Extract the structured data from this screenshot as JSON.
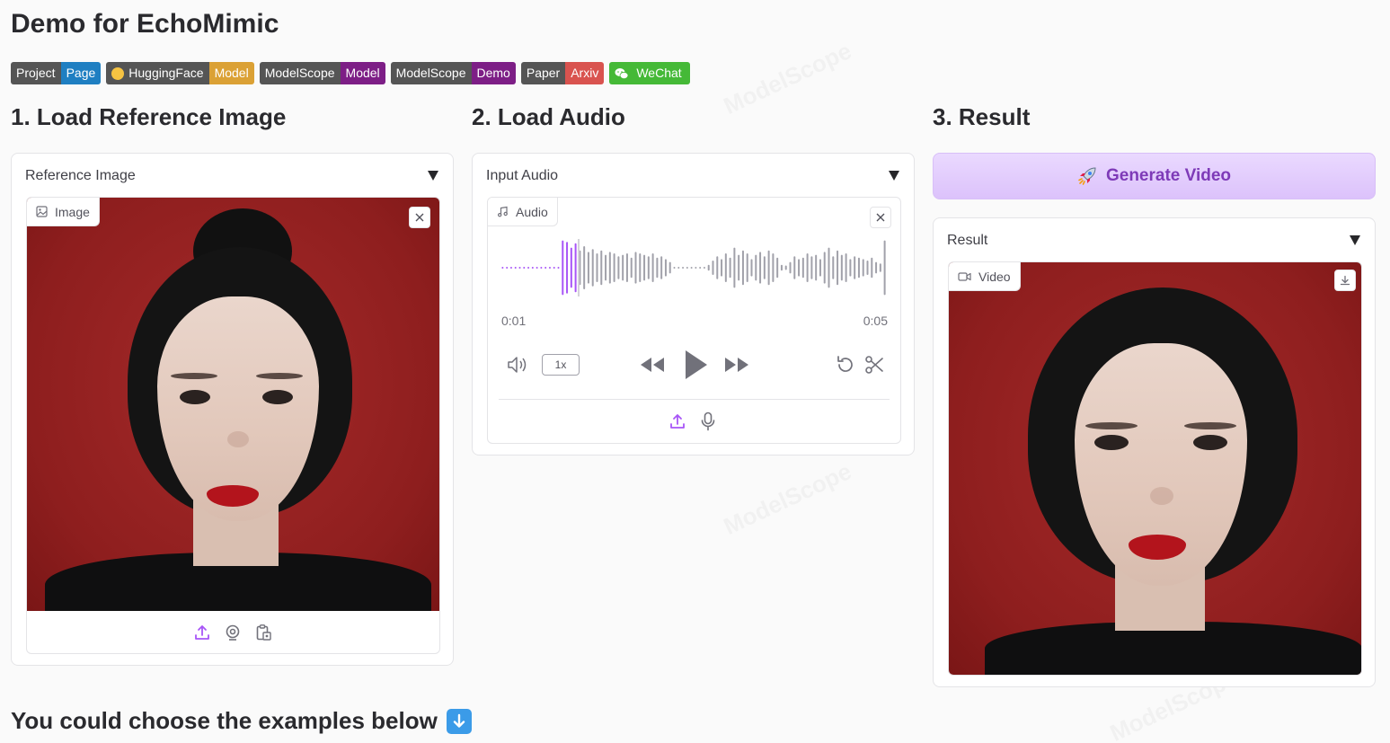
{
  "page": {
    "title": "Demo for EchoMimic",
    "examples_heading": "You could choose the examples below"
  },
  "badges": [
    {
      "left": "Project",
      "right": "Page",
      "right_color": "#1f7fc2"
    },
    {
      "left": "HuggingFace",
      "right": "Model",
      "right_color": "#dba135"
    },
    {
      "left": "ModelScope",
      "right": "Model",
      "right_color": "#7d1e86"
    },
    {
      "left": "ModelScope",
      "right": "Demo",
      "right_color": "#7d1e86"
    },
    {
      "left": "Paper",
      "right": "Arxiv",
      "right_color": "#d9534f"
    },
    {
      "left": "",
      "right": "WeChat",
      "right_color": "#45b937"
    }
  ],
  "sections": {
    "reference": {
      "heading": "1. Load Reference Image",
      "panel_label": "Reference Image",
      "tag_label": "Image"
    },
    "audio": {
      "heading": "2. Load Audio",
      "panel_label": "Input Audio",
      "tag_label": "Audio",
      "time_current": "0:01",
      "time_total": "0:05",
      "speed": "1x",
      "progress": 0.2
    },
    "result": {
      "heading": "3. Result",
      "generate_button": "Generate Video",
      "panel_label": "Result",
      "tag_label": "Video"
    }
  },
  "colors": {
    "accent": "#a855f7",
    "button_text": "#7e3ab8"
  },
  "icons": [
    "upload-icon",
    "webcam-icon",
    "clipboard-icon",
    "mic-icon",
    "volume-icon",
    "rewind-icon",
    "play-icon",
    "fast-forward-icon",
    "reset-icon",
    "scissors-icon",
    "download-icon",
    "rocket-icon",
    "close-icon",
    "image-icon",
    "music-icon",
    "video-icon"
  ]
}
